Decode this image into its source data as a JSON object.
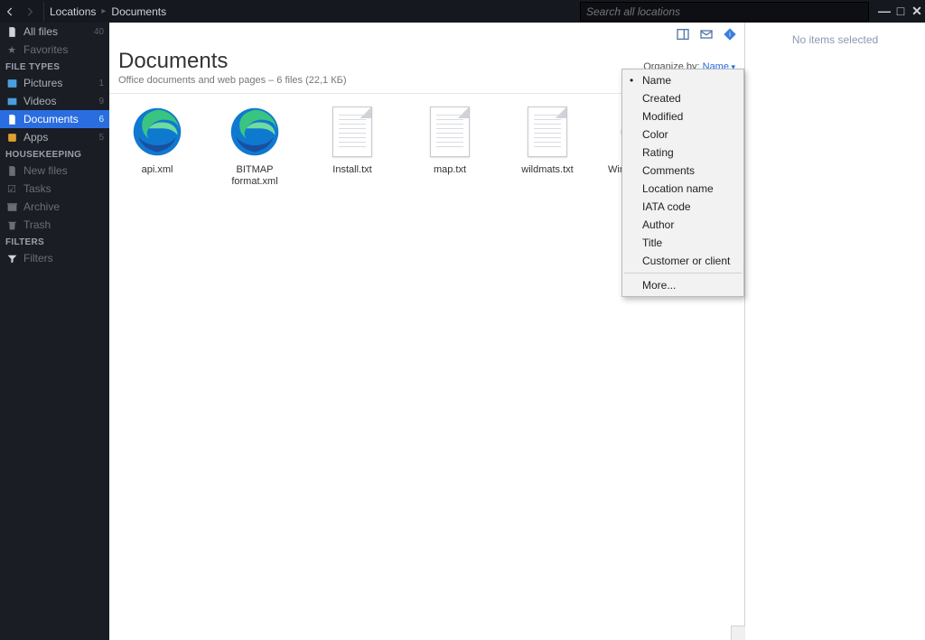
{
  "breadcrumb": {
    "root": "Locations",
    "current": "Documents"
  },
  "search": {
    "placeholder": "Search all locations"
  },
  "sidebar": {
    "top": [
      {
        "label": "All files",
        "count": "40",
        "icon": "file"
      },
      {
        "label": "Favorites",
        "count": "",
        "icon": "star"
      }
    ],
    "filetypes_header": "FILE TYPES",
    "filetypes": [
      {
        "label": "Pictures",
        "count": "1",
        "icon": "picture"
      },
      {
        "label": "Videos",
        "count": "9",
        "icon": "video"
      },
      {
        "label": "Documents",
        "count": "6",
        "icon": "doc",
        "active": true
      },
      {
        "label": "Apps",
        "count": "5",
        "icon": "app"
      }
    ],
    "housekeeping_header": "HOUSEKEEPING",
    "housekeeping": [
      {
        "label": "New files",
        "icon": "file"
      },
      {
        "label": "Tasks",
        "icon": "check"
      },
      {
        "label": "Archive",
        "icon": "archive"
      },
      {
        "label": "Trash",
        "icon": "trash"
      }
    ],
    "filters_header": "FILTERS",
    "filters": [
      {
        "label": "Filters",
        "icon": "filter"
      }
    ]
  },
  "page": {
    "title": "Documents",
    "subtitle": "Office documents and web pages – 6 files (22,1 КБ)",
    "organize_label": "Organize by:",
    "organize_value": "Name"
  },
  "files": [
    {
      "name": "api.xml",
      "kind": "edge"
    },
    {
      "name": "BITMAP format.xml",
      "kind": "edge"
    },
    {
      "name": "Install.txt",
      "kind": "txt"
    },
    {
      "name": "map.txt",
      "kind": "txt"
    },
    {
      "name": "wildmats.txt",
      "kind": "txt"
    },
    {
      "name": "Windows Bitmap format.xml",
      "kind": "edge"
    }
  ],
  "menu": {
    "items": [
      "Name",
      "Created",
      "Modified",
      "Color",
      "Rating",
      "Comments",
      "Location name",
      "IATA code",
      "Author",
      "Title",
      "Customer or client"
    ],
    "selected": "Name",
    "more": "More..."
  },
  "info": {
    "empty": "No items selected"
  }
}
